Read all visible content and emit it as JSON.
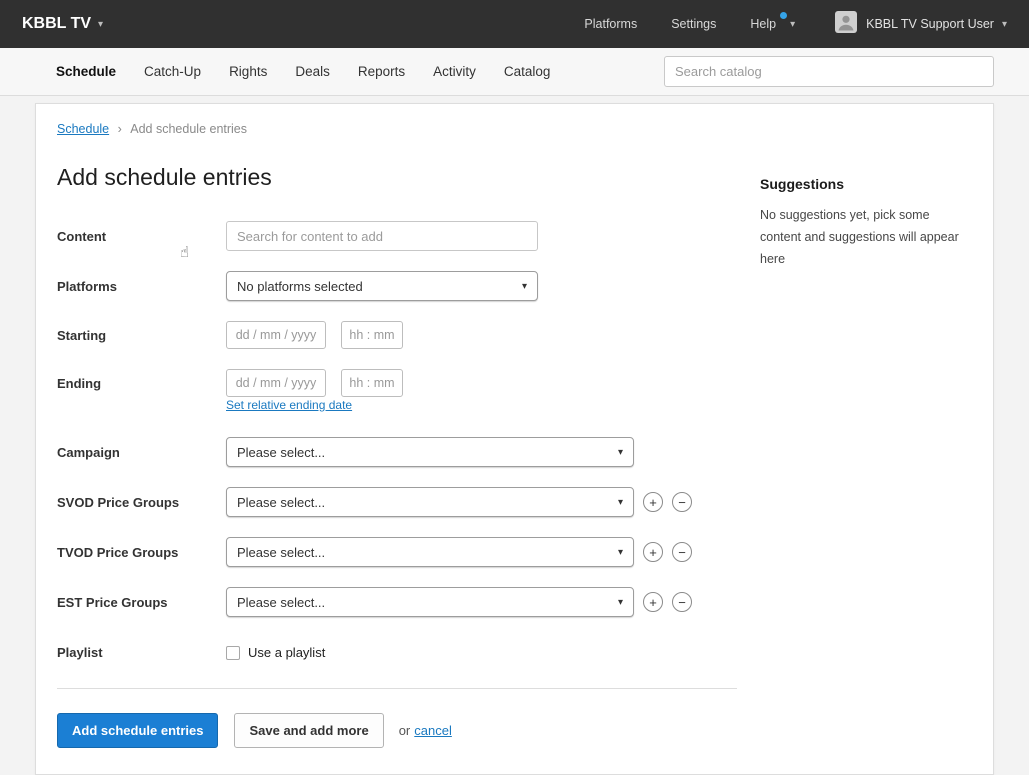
{
  "colors": {
    "topbar-bg": "#303030",
    "accent": "#1b7fd4",
    "link": "#1a79c0"
  },
  "icons": {
    "caret_down": "▾",
    "add": "+",
    "remove": "−",
    "pointer": "☝"
  },
  "topbar": {
    "brand": "KBBL TV",
    "items": [
      {
        "label": "Platforms"
      },
      {
        "label": "Settings"
      },
      {
        "label": "Help",
        "has_notification": true
      }
    ],
    "user": {
      "name": "KBBL TV Support User"
    }
  },
  "subnav": {
    "tabs": [
      {
        "label": "Schedule",
        "active": true
      },
      {
        "label": "Catch-Up"
      },
      {
        "label": "Rights"
      },
      {
        "label": "Deals"
      },
      {
        "label": "Reports"
      },
      {
        "label": "Activity"
      },
      {
        "label": "Catalog"
      }
    ],
    "search": {
      "placeholder": "Search catalog",
      "value": ""
    }
  },
  "breadcrumb": {
    "parent": "Schedule",
    "separator": "›",
    "current": "Add schedule entries"
  },
  "page": {
    "title": "Add schedule entries"
  },
  "suggestions": {
    "title": "Suggestions",
    "body": "No suggestions yet, pick some content and suggestions will appear here"
  },
  "form": {
    "content": {
      "label": "Content",
      "placeholder": "Search for content to add",
      "value": ""
    },
    "platforms": {
      "label": "Platforms",
      "selected": "No platforms selected"
    },
    "starting": {
      "label": "Starting",
      "date_placeholder": "dd / mm / yyyy",
      "time_placeholder": "hh : mm"
    },
    "ending": {
      "label": "Ending",
      "date_placeholder": "dd / mm / yyyy",
      "time_placeholder": "hh : mm",
      "relative_link": "Set relative ending date"
    },
    "campaign": {
      "label": "Campaign",
      "selected": "Please select..."
    },
    "svod_price_groups": {
      "label": "SVOD Price Groups",
      "selected": "Please select..."
    },
    "tvod_price_groups": {
      "label": "TVOD Price Groups",
      "selected": "Please select..."
    },
    "est_price_groups": {
      "label": "EST Price Groups",
      "selected": "Please select..."
    },
    "playlist": {
      "label": "Playlist",
      "checkbox_label": "Use a playlist",
      "checked": false
    }
  },
  "actions": {
    "submit": "Add schedule entries",
    "save_more": "Save and add more",
    "or": "or",
    "cancel": "cancel"
  }
}
